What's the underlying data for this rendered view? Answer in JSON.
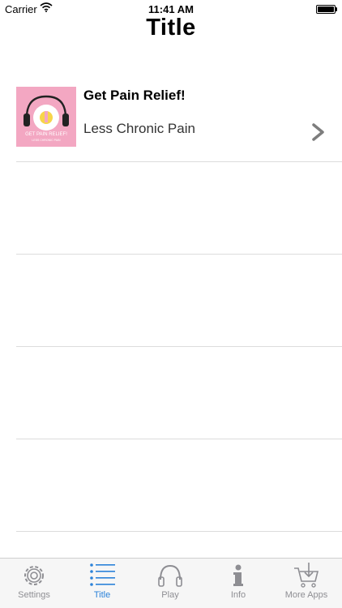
{
  "status_bar": {
    "carrier": "Carrier",
    "time": "11:41 AM"
  },
  "nav": {
    "title": "Title"
  },
  "list": {
    "items": [
      {
        "title": "Get Pain Relief!",
        "subtitle": "Less Chronic Pain",
        "thumb_text": "GET PAIN RELIEF!",
        "thumb_subtext": "LESS CHRONIC PAIN"
      }
    ]
  },
  "tab_bar": {
    "active": "Title",
    "tabs": [
      {
        "label": "Settings",
        "icon": "gear-icon"
      },
      {
        "label": "Title",
        "icon": "list-icon"
      },
      {
        "label": "Play",
        "icon": "headphones-icon"
      },
      {
        "label": "Info",
        "icon": "info-icon"
      },
      {
        "label": "More Apps",
        "icon": "cart-icon"
      }
    ]
  },
  "colors": {
    "active_tab": "#2b82d9",
    "inactive_tab": "#8e8e93",
    "thumb_bg": "#f3a7c2"
  }
}
